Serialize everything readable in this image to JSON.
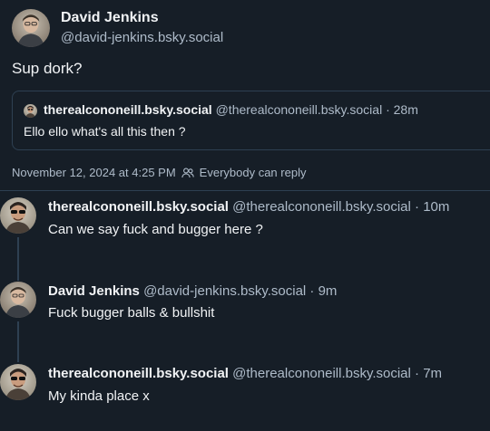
{
  "post": {
    "author_name": "David Jenkins",
    "author_handle": "@david-jenkins.bsky.social",
    "text": "Sup dork?",
    "quote": {
      "author_name": "therealcononeill.bsky.social",
      "author_handle": "@therealcononeill.bsky.social",
      "time": "· 28m",
      "text": "Ello ello what's all this then ?"
    },
    "timestamp": "November 12, 2024 at 4:25 PM",
    "reply_setting": "Everybody can reply"
  },
  "replies": [
    {
      "author_name": "therealcononeill.bsky.social",
      "author_handle": "@therealcononeill.bsky.social",
      "time": "· 10m",
      "text": "Can we say fuck and bugger here ?"
    },
    {
      "author_name": "David Jenkins",
      "author_handle": "@david-jenkins.bsky.social",
      "time": "· 9m",
      "text": "Fuck bugger balls & bullshit"
    },
    {
      "author_name": "therealcononeill.bsky.social",
      "author_handle": "@therealcononeill.bsky.social",
      "time": "· 7m",
      "text": "My kinda place x"
    }
  ],
  "icons": {
    "avatar_david": "avatar-david",
    "avatar_conor": "avatar-conor",
    "reply_setting": "people-icon"
  },
  "colors": {
    "background": "#161e27",
    "text": "#f1f3f5",
    "muted": "#aebbc9",
    "border": "#2e4052"
  }
}
